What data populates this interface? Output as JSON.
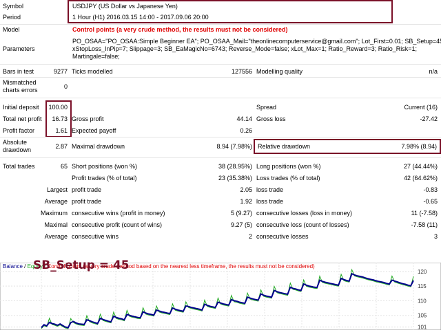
{
  "header": {
    "symbol_label": "Symbol",
    "symbol_value": "USDJPY (US Dollar vs Japanese Yen)",
    "period_label": "Period",
    "period_value": "1 Hour (H1) 2016.03.15 14:00 - 2017.09.06 20:00",
    "model_label": "Model",
    "model_value": "Control points (a very crude method, the results must not be considered)",
    "parameters_label": "Parameters",
    "parameters_lines": [
      "PO_OSAA=\"PO_OSAA:Simple Beginner EA\"; PO_OSAA_Mail=\"theonlinecomputerservice@gmail.com\"; Lot_First=0.01; SB_Setup=45;",
      "xStopLoss_InPip=7; Slippage=3; SB_EaMagicNo=6743; Reverse_Mode=false; xLot_Max=1; Ratio_Reward=3; Ratio_Risk=1;",
      "Martingale=false;"
    ]
  },
  "summary": {
    "bars_label": "Bars in test",
    "bars_value": "9277",
    "ticks_label": "Ticks modelled",
    "ticks_value": "127556",
    "quality_label": "Modelling quality",
    "quality_value": "n/a",
    "mismatch_label_1": "Mismatched",
    "mismatch_label_2": "charts errors",
    "mismatch_value": "0",
    "deposit_label": "Initial deposit",
    "deposit_value": "100.00",
    "spread_label": "Spread",
    "spread_value": "Current (16)",
    "netprofit_label": "Total net profit",
    "netprofit_value": "16.73",
    "grossprofit_label": "Gross profit",
    "grossprofit_value": "44.14",
    "grossloss_label": "Gross loss",
    "grossloss_value": "-27.42",
    "pf_label": "Profit factor",
    "pf_value": "1.61",
    "payoff_label": "Expected payoff",
    "payoff_value": "0.26",
    "absdd_label_1": "Absolute",
    "absdd_label_2": "drawdown",
    "absdd_value": "2.87",
    "maxdd_label": "Maximal drawdown",
    "maxdd_value": "8.94 (7.98%)",
    "reldd_label": "Relative drawdown",
    "reldd_value": "7.98% (8.94)"
  },
  "trades": {
    "total_label": "Total trades",
    "total_value": "65",
    "short_label": "Short positions (won %)",
    "short_value": "38 (28.95%)",
    "long_label": "Long positions (won %)",
    "long_value": "27 (44.44%)",
    "profit_trades_label": "Profit trades (% of total)",
    "profit_trades_value": "23 (35.38%)",
    "loss_trades_label": "Loss trades (% of total)",
    "loss_trades_value": "42 (64.62%)",
    "largest_label": "Largest",
    "largest_profit_label": "profit trade",
    "largest_profit_value": "2.05",
    "largest_loss_label": "loss trade",
    "largest_loss_value": "-0.83",
    "average_label": "Average",
    "average_profit_label": "profit trade",
    "average_profit_value": "1.92",
    "average_loss_label": "loss trade",
    "average_loss_value": "-0.65",
    "maximum_label": "Maximum",
    "max_wins_label": "consecutive wins (profit in money)",
    "max_wins_value": "5 (9.27)",
    "max_losses_label": "consecutive losses (loss in money)",
    "max_losses_value": "11 (-7.58)",
    "maximal_label": "Maximal",
    "maximal_profit_label": "consecutive profit (count of wins)",
    "maximal_profit_value": "9.27 (5)",
    "maximal_loss_label": "consecutive loss (count of losses)",
    "maximal_loss_value": "-7.58 (11)",
    "avg2_label": "Average",
    "avg_wins_label": "consecutive wins",
    "avg_wins_value": "2",
    "avg_losses_label": "consecutive losses",
    "avg_losses_value": "3"
  },
  "chart_legend": {
    "balance": "Balance",
    "sep1": " / ",
    "equity": "Equity",
    "sep2": " / ",
    "note": "Control points (a very crude method based on the nearest less timeframe, the results must not be considered)"
  },
  "overlay_label": "SB_Setup = 45",
  "colors": {
    "balance": "#00008b",
    "equity": "#22aa22",
    "warning": "#e00000",
    "highlight_box": "#7a1028"
  },
  "chart_data": {
    "type": "line",
    "ylim": [
      100,
      123
    ],
    "yticks": [
      101,
      105,
      110,
      115,
      120
    ],
    "series": [
      {
        "name": "Balance",
        "values": [
          100.8,
          101.8,
          101.4,
          102.6,
          102.2,
          102.0,
          101.6,
          102.1,
          101.5,
          101.0,
          100.8,
          102.5,
          102.9,
          102.4,
          102.1,
          102.0,
          101.9,
          103.5,
          103.2,
          102.8,
          102.5,
          102.2,
          104.0,
          103.6,
          103.3,
          103.0,
          102.8,
          104.7,
          104.3,
          104.0,
          103.8,
          103.5,
          105.3,
          105.0,
          104.7,
          104.5,
          104.3,
          104.2,
          106.2,
          105.8,
          105.5,
          105.3,
          105.1,
          106.8,
          106.5,
          106.2,
          106.0,
          105.8,
          105.6,
          107.5,
          107.1,
          106.8,
          106.6,
          106.4,
          108.2,
          108.0,
          107.7,
          107.5,
          107.3,
          107.1,
          106.8,
          108.8,
          108.4,
          108.1,
          107.9,
          107.7,
          109.5,
          109.2,
          108.9,
          108.7,
          108.5,
          110.4,
          110.0,
          109.8,
          109.5,
          109.3,
          109.1,
          111.2,
          110.9,
          110.6,
          110.4,
          110.2,
          112.3,
          111.9,
          111.6,
          111.4,
          111.2,
          113.5,
          113.1,
          112.8,
          112.6,
          112.4,
          112.2,
          114.6,
          114.2,
          114.0,
          113.7,
          113.5,
          115.7,
          115.3,
          115.0,
          114.8,
          114.6,
          114.5,
          117.0,
          116.6,
          116.3,
          116.1,
          115.9,
          115.7,
          115.5,
          115.3,
          117.6,
          117.2,
          116.9,
          116.7,
          119.2,
          118.8,
          118.5,
          118.3,
          118.1,
          117.8,
          117.5,
          117.3,
          117.1,
          116.8,
          116.6,
          116.4,
          116.2,
          115.9,
          115.7,
          117.0,
          116.7,
          116.4,
          116.1,
          115.8,
          115.6,
          115.3,
          115.1,
          116.9
        ],
        "color": "#00008b"
      }
    ]
  }
}
